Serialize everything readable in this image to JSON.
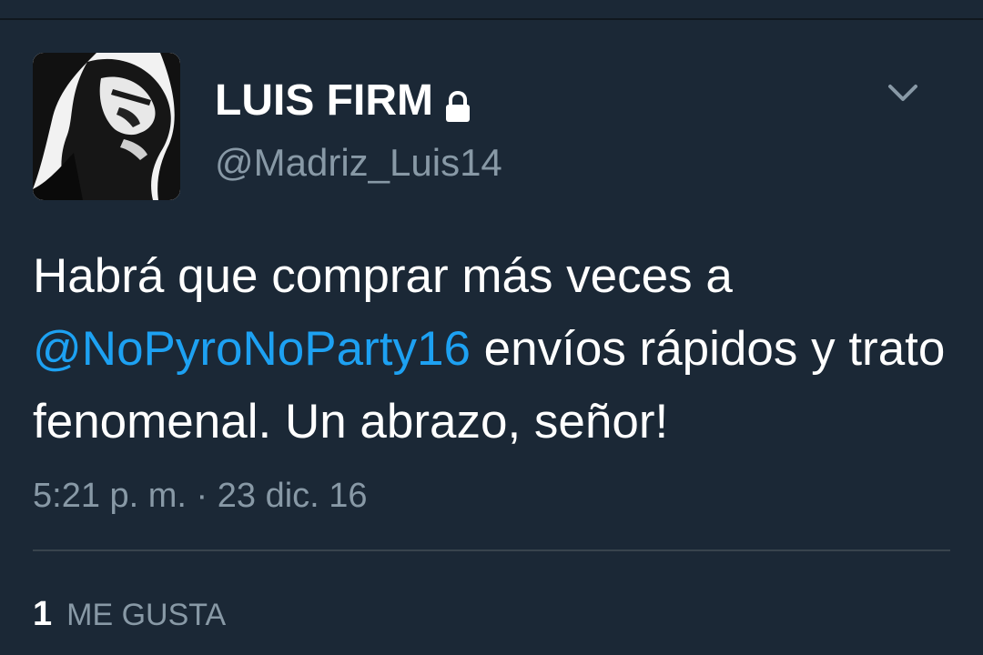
{
  "tweet": {
    "author": {
      "display_name": "LUIS FIRM",
      "handle": "@Madriz_Luis14",
      "protected": true
    },
    "text_before_mention": "Habrá que comprar más veces a ",
    "mention": "@NoPyroNoParty16",
    "text_after_mention": " envíos rápidos y trato fenomenal. Un abrazo, señor!",
    "timestamp": "5:21 p. m. · 23 dic. 16",
    "likes": {
      "count": "1",
      "label": "ME GUSTA"
    }
  },
  "icons": {
    "lock": "lock-icon",
    "menu": "chevron-down-icon"
  },
  "colors": {
    "background": "#1b2836",
    "text": "#ffffff",
    "secondary_text": "#8899a6",
    "link": "#1da1f2",
    "divider": "#38444d"
  }
}
